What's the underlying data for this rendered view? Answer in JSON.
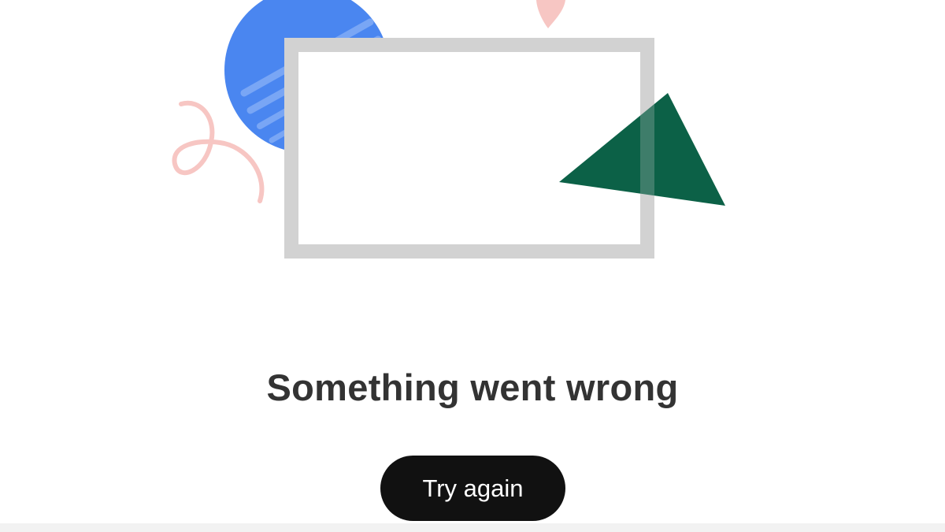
{
  "error": {
    "title": "Something went wrong",
    "button_label": "Try again"
  },
  "illustration": {
    "shapes": [
      "pink-squiggle",
      "blue-circle",
      "gray-frame",
      "green-triangle",
      "pink-drop"
    ],
    "colors": {
      "blue": "#4a86f0",
      "blue_stripe": "#79a6f5",
      "frame": "#d2d2d2",
      "green": "#0c6147",
      "pink": "#f7c6c3"
    }
  },
  "colors": {
    "button_bg": "#111111",
    "button_text": "#ffffff",
    "title_text": "#333333",
    "background": "#ffffff"
  }
}
